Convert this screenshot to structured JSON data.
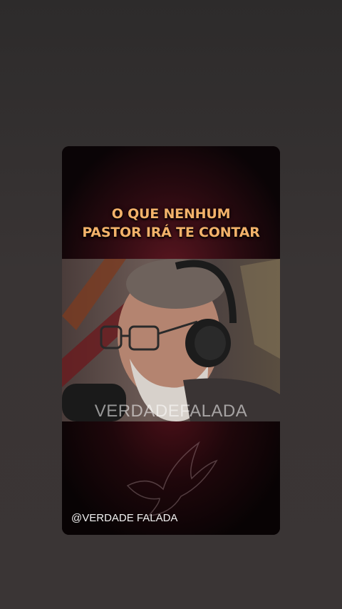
{
  "headline": {
    "line1": "O QUE NENHUM",
    "line2": "PASTOR IRÁ TE CONTAR"
  },
  "video": {
    "watermark": "VERDADEFALADA"
  },
  "footer": {
    "handle": "@VERDADE FALADA"
  },
  "icons": [
    "dove-icon"
  ],
  "colors": {
    "background": "#353131",
    "headline": "#f2b26a",
    "panel_red": "#5a1620"
  }
}
